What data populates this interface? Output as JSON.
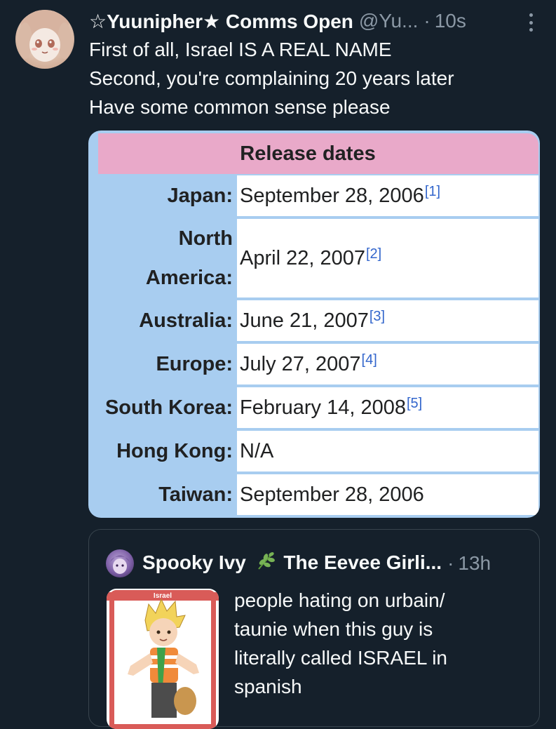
{
  "tweet": {
    "display_name": "☆Yuunipher★ Comms Open",
    "handle": "@Yu...",
    "separator": "·",
    "time": "10s",
    "more_icon": "more-vertical-icon",
    "text_lines": [
      "First of all, Israel IS A REAL NAME",
      "Second, you're complaining 20 years later",
      "Have some common sense please"
    ]
  },
  "release_table": {
    "title": "Release dates",
    "rows": [
      {
        "region": "Japan:",
        "date": "September 28, 2006",
        "ref": "[1]"
      },
      {
        "region_line1": "North",
        "region_line2": "America:",
        "date": "April 22, 2007",
        "ref": "[2]"
      },
      {
        "region": "Australia:",
        "date": "June 21, 2007",
        "ref": "[3]"
      },
      {
        "region": "Europe:",
        "date": "July 27, 2007",
        "ref": "[4]"
      },
      {
        "region": "South Korea:",
        "date": "February 14, 2008",
        "ref": "[5]"
      },
      {
        "region": "Hong Kong:",
        "date": "N/A",
        "ref": ""
      },
      {
        "region": "Taiwan:",
        "date": "September 28, 2006",
        "ref": ""
      }
    ],
    "colors": {
      "header": "#e9a9c9",
      "label_bg": "#a8cdf0",
      "value_bg": "#ffffff",
      "ref_link": "#3366cc"
    }
  },
  "quoted_tweet": {
    "display_name_part1": "Spooky Ivy",
    "emoji": "herb-emoji",
    "display_name_part2": "The Eevee Girli...",
    "separator": "·",
    "time": "13h",
    "thumbnail_caption": "Israel",
    "text_lines": [
      "people hating on urbain/",
      "taunie when this guy is",
      "literally called ISRAEL in",
      "spanish"
    ]
  },
  "colors": {
    "background": "#15202b",
    "text": "#f7f9f9",
    "muted": "#8b98a5",
    "border": "#38444d"
  }
}
